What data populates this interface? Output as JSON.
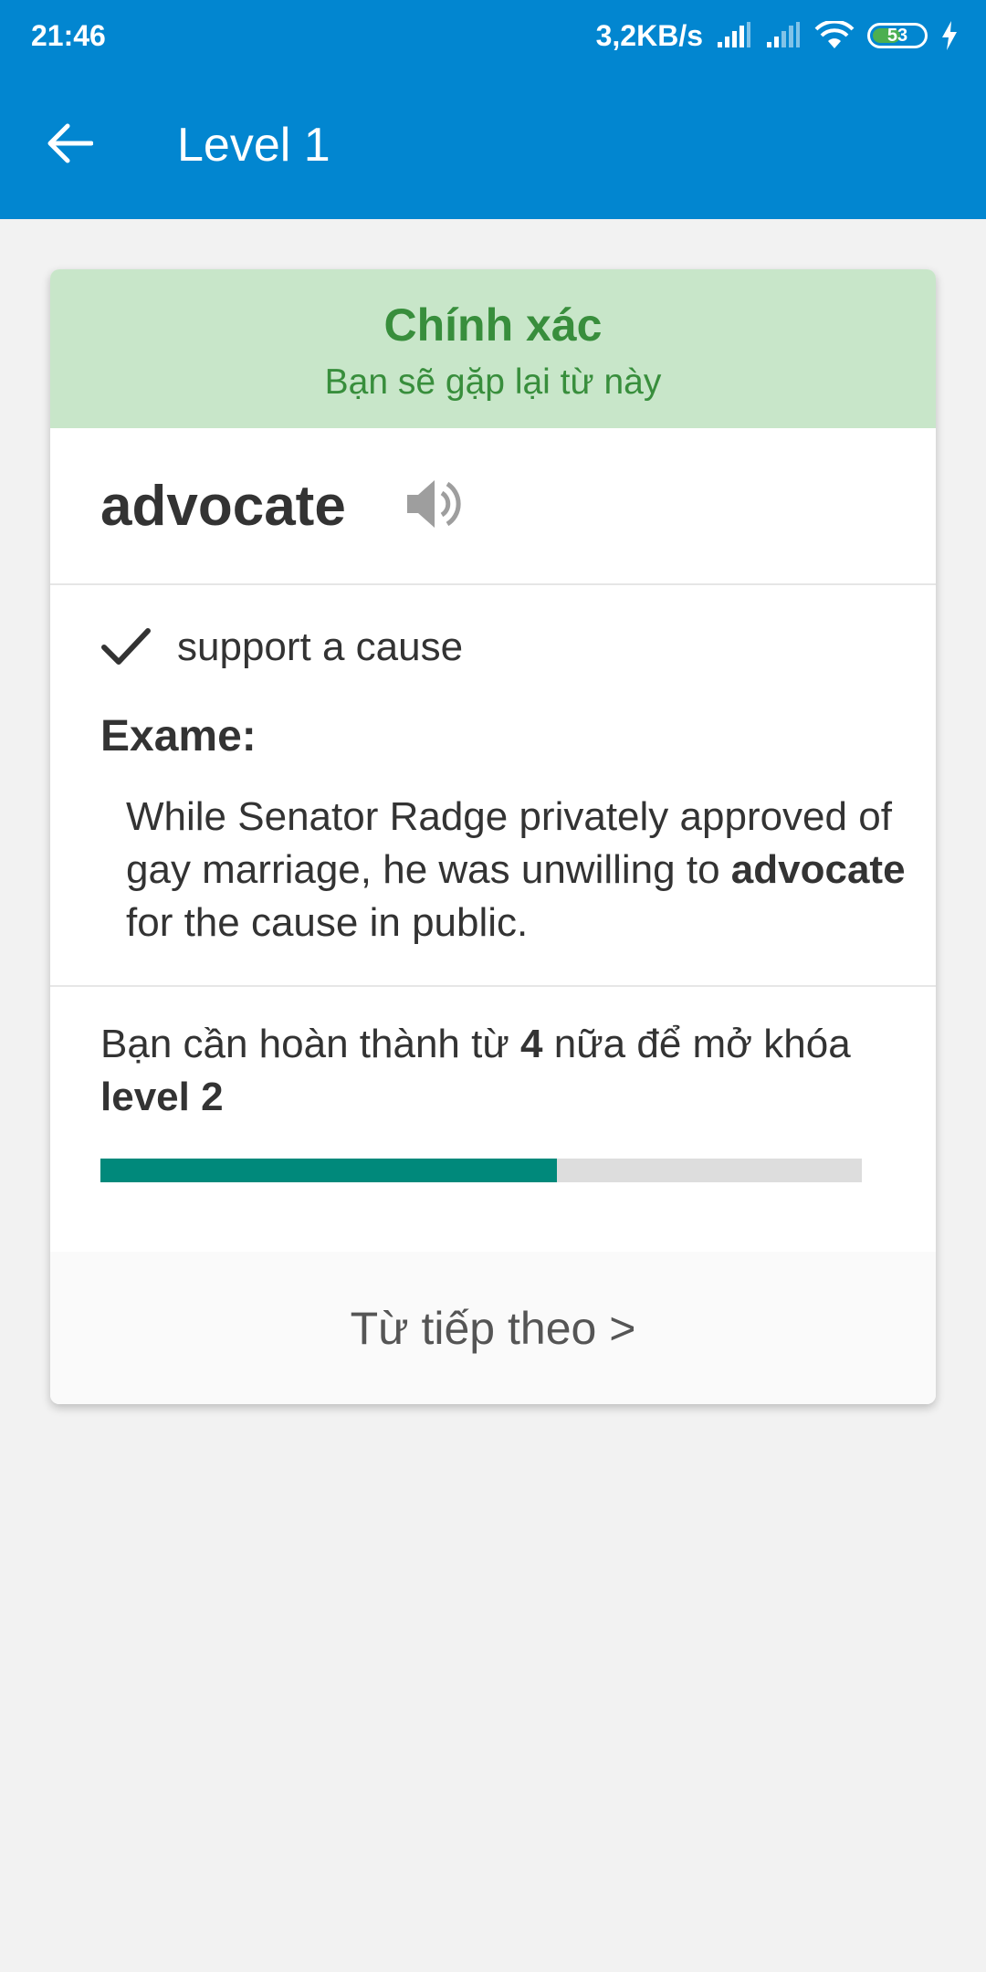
{
  "status_bar": {
    "time": "21:46",
    "network_speed": "3,2KB/s",
    "battery_level": "53",
    "icons": [
      "signal-icon",
      "signal-icon",
      "wifi-icon",
      "battery-icon",
      "charging-icon"
    ]
  },
  "app_bar": {
    "title": "Level 1",
    "back_icon": "arrow-left-icon"
  },
  "result": {
    "title": "Chính xác",
    "subtitle": "Bạn sẽ gặp lại từ này"
  },
  "word": {
    "text": "advocate",
    "audio_icon": "speaker-icon"
  },
  "meaning": {
    "text": "support a cause",
    "icon": "check-icon"
  },
  "example": {
    "label": "Exame:",
    "before": "While Senator Radge privately approved of gay marriage, he was unwilling to ",
    "highlight": "advocate",
    "after": " for the cause in public."
  },
  "progress": {
    "text_before": "Bạn cần hoàn thành từ ",
    "count": "4",
    "text_middle": " nữa để mở khóa ",
    "next_level": "level 2",
    "fraction": 0.6
  },
  "next_button": {
    "label": "Từ tiếp theo >"
  },
  "colors": {
    "primary": "#0286d0",
    "success_bg": "#c8e6c9",
    "success_text": "#388e3c",
    "progress_fill": "#00897b",
    "progress_track": "#dddddd"
  }
}
